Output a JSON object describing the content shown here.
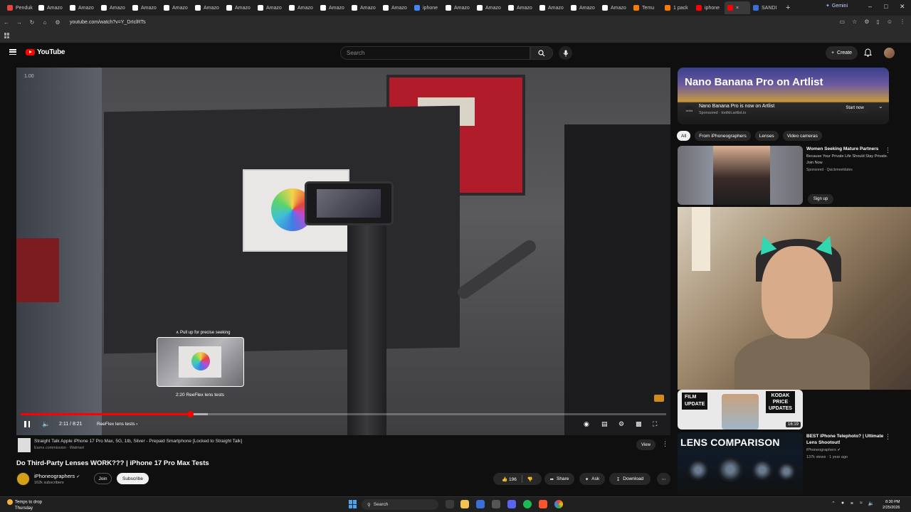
{
  "browser": {
    "tabs": [
      {
        "label": "Penduk",
        "color": "#e8453c"
      },
      {
        "label": "Amazo",
        "color": "#ffffff"
      },
      {
        "label": "Amazo",
        "color": "#ffffff"
      },
      {
        "label": "Amazo",
        "color": "#ffffff"
      },
      {
        "label": "Amazo",
        "color": "#ffffff"
      },
      {
        "label": "Amazo",
        "color": "#ffffff"
      },
      {
        "label": "Amazo",
        "color": "#ffffff"
      },
      {
        "label": "Amazo",
        "color": "#ffffff"
      },
      {
        "label": "Amazo",
        "color": "#ffffff"
      },
      {
        "label": "Amazo",
        "color": "#ffffff"
      },
      {
        "label": "Amazo",
        "color": "#ffffff"
      },
      {
        "label": "Amazo",
        "color": "#ffffff"
      },
      {
        "label": "Amazo",
        "color": "#ffffff"
      },
      {
        "label": "iphone",
        "color": "#4285f4"
      },
      {
        "label": "Amazo",
        "color": "#ffffff"
      },
      {
        "label": "Amazo",
        "color": "#ffffff"
      },
      {
        "label": "Amazo",
        "color": "#ffffff"
      },
      {
        "label": "Amazo",
        "color": "#ffffff"
      },
      {
        "label": "Amazo",
        "color": "#ffffff"
      },
      {
        "label": "Amazo",
        "color": "#ffffff"
      },
      {
        "label": "Temu",
        "color": "#f57c00"
      },
      {
        "label": "1 pack",
        "color": "#f57c00"
      },
      {
        "label": "iphone",
        "color": "#ff0000"
      }
    ],
    "active_tab_color": "#ff0000",
    "extra_tab": "SANDI",
    "gemini_label": "Gemini",
    "url": "youtube.com/watch?v=Y_DrIclRTs"
  },
  "youtube": {
    "logo_text": "YouTube",
    "search_placeholder": "Search",
    "create_label": "Create"
  },
  "player": {
    "speed_badge": "1.00",
    "seek_hint": "∧ Pull up for precise seeking",
    "seek_preview_label": "2:20  ReeFlex lens tests",
    "current_time": "2:11 / 8:21",
    "chapter": "ReeFlex lens tests",
    "progress_played": 0.262,
    "progress_buffered": 0.29
  },
  "ad": {
    "title": "Straight Talk Apple iPhone 17 Pro Max, 5G, 1tb, Silver - Prepaid Smartphone [Locked to Straight Talk]",
    "sub": "Earns commission  ·  Walmart",
    "view_label": "View"
  },
  "video": {
    "title": "Do Third-Party Lenses WORK??? | iPhone 17 Pro Max Tests",
    "channel": "iPhoneographers",
    "subscribers": "162k subscribers",
    "join_label": "Join",
    "subscribe_label": "Subscribe",
    "likes": "196",
    "share_label": "Share",
    "ask_label": "Ask",
    "download_label": "Download"
  },
  "sidebar": {
    "banner": {
      "title": "Nano Banana Pro on Artlist",
      "name": "Nano Banana Pro is now on Artlist",
      "sponsored": "Sponsored · toolkit.artlist.io",
      "cta": "Start now",
      "logo_text": "Artlist"
    },
    "chips": [
      "All",
      "From iPhoneographers",
      "Lenses",
      "Video cameras"
    ],
    "ad2": {
      "title": "Women Seeking Mature Partners",
      "desc": "Because Your Private Life Should Stay Private. Join Now",
      "sponsored": "Sponsored · Quickmeetdates",
      "cta": "Sign up"
    },
    "rec1": {
      "left_text": "FILM\nUPDATE",
      "right_text": "KODAK\nPRICE\nUPDATES",
      "duration": "16:19"
    },
    "rec2": {
      "headline": "LENS COMPARISON",
      "title": "BEST iPhone Telephoto? | Ultimate Lens Shootout!",
      "channel": "iPhoneographers",
      "meta": "137k views · 1 year ago"
    }
  },
  "taskbar": {
    "weather_line1": "Temps to drop",
    "weather_line2": "Thursday",
    "search_label": "Search",
    "time": "8:30 PM",
    "date": "2/25/2026"
  }
}
